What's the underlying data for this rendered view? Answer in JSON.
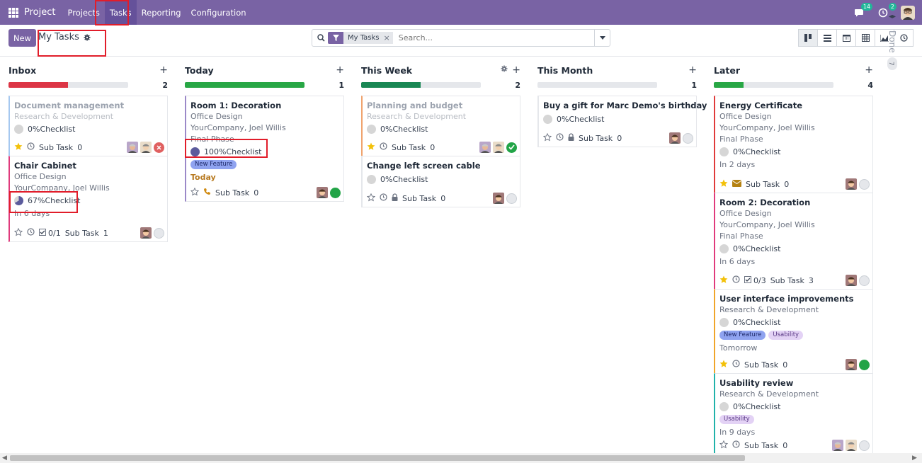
{
  "topbar": {
    "app_name": "Project",
    "menu": [
      {
        "label": "Projects",
        "active": false
      },
      {
        "label": "Tasks",
        "active": true
      },
      {
        "label": "Reporting",
        "active": false
      },
      {
        "label": "Configuration",
        "active": false
      }
    ],
    "messages_count": "14",
    "activities_count": "2"
  },
  "control": {
    "new_label": "New",
    "breadcrumb": "My Tasks",
    "filter_facet": "My Tasks",
    "search_placeholder": "Search..."
  },
  "colors": {
    "brand": "#7963a4",
    "progress_red": "#dc3545",
    "progress_green": "#28a745",
    "progress_dark_green": "#198754"
  },
  "columns": [
    {
      "title": "Inbox",
      "count": "2",
      "gear": false,
      "cards": [
        {
          "title": "Document management",
          "muted": true,
          "lines": [
            "Research & Development"
          ],
          "checklist": "0%Checklist",
          "check_state": "empty",
          "tags": [],
          "deadline": "",
          "starred": true,
          "subtask": "Sub Task",
          "subtask_count": "0",
          "todo": "",
          "status": "cancelled"
        },
        {
          "title": "Chair Cabinet",
          "muted": false,
          "lines": [
            "Office Design",
            "YourCompany, Joel Willis"
          ],
          "checklist": "67%Checklist",
          "check_state": "partial",
          "tags": [],
          "deadline": "In 6 days",
          "starred": false,
          "subtask": "Sub Task",
          "subtask_count": "1",
          "todo": "0/1",
          "status": "normal"
        }
      ]
    },
    {
      "title": "Today",
      "count": "1",
      "gear": false,
      "cards": [
        {
          "title": "Room 1: Decoration",
          "muted": false,
          "lines": [
            "Office Design",
            "YourCompany, Joel Willis",
            "Final Phase"
          ],
          "checklist": "100%Checklist",
          "check_state": "full",
          "tags": [
            "New Feature"
          ],
          "deadline": "Today",
          "starred": false,
          "subtask": "Sub Task",
          "subtask_count": "0",
          "todo": "",
          "status": "green"
        }
      ]
    },
    {
      "title": "This Week",
      "count": "2",
      "gear": true,
      "cards": [
        {
          "title": "Planning and budget",
          "muted": true,
          "lines": [
            "Research & Development"
          ],
          "checklist": "0%Checklist",
          "check_state": "empty",
          "tags": [],
          "deadline": "",
          "starred": true,
          "subtask": "Sub Task",
          "subtask_count": "0",
          "todo": "",
          "status": "done"
        },
        {
          "title": "Change left screen cable",
          "muted": false,
          "lines": [],
          "checklist": "0%Checklist",
          "check_state": "empty",
          "tags": [],
          "deadline": "",
          "starred": false,
          "subtask": "Sub Task",
          "subtask_count": "0",
          "todo": "",
          "status": "normal"
        }
      ]
    },
    {
      "title": "This Month",
      "count": "1",
      "gear": false,
      "cards": [
        {
          "title": "Buy a gift for Marc Demo's birthday",
          "muted": false,
          "lines": [],
          "checklist": "0%Checklist",
          "check_state": "empty",
          "tags": [],
          "deadline": "",
          "starred": false,
          "subtask": "Sub Task",
          "subtask_count": "0",
          "todo": "",
          "status": "normal"
        }
      ]
    },
    {
      "title": "Later",
      "count": "4",
      "gear": false,
      "cards": [
        {
          "title": "Energy Certificate",
          "muted": false,
          "lines": [
            "Office Design",
            "YourCompany, Joel Willis",
            "Final Phase"
          ],
          "checklist": "0%Checklist",
          "check_state": "empty",
          "tags": [],
          "deadline": "In 2 days",
          "starred": true,
          "subtask": "Sub Task",
          "subtask_count": "0",
          "todo": "",
          "status": "normal"
        },
        {
          "title": "Room 2: Decoration",
          "muted": false,
          "lines": [
            "Office Design",
            "YourCompany, Joel Willis",
            "Final Phase"
          ],
          "checklist": "0%Checklist",
          "check_state": "empty",
          "tags": [],
          "deadline": "In 6 days",
          "starred": true,
          "subtask": "Sub Task",
          "subtask_count": "3",
          "todo": "0/3",
          "status": "normal"
        },
        {
          "title": "User interface improvements",
          "muted": false,
          "lines": [
            "Research & Development"
          ],
          "checklist": "0%Checklist",
          "check_state": "empty",
          "tags": [
            "New Feature",
            "Usability"
          ],
          "deadline": "Tomorrow",
          "starred": true,
          "subtask": "Sub Task",
          "subtask_count": "0",
          "todo": "",
          "status": "green"
        },
        {
          "title": "Usability review",
          "muted": false,
          "lines": [
            "Research & Development"
          ],
          "checklist": "0%Checklist",
          "check_state": "empty",
          "tags": [
            "Usability"
          ],
          "deadline": "In 9 days",
          "starred": false,
          "subtask": "Sub Task",
          "subtask_count": "0",
          "todo": "",
          "status": "normal"
        }
      ]
    }
  ],
  "folded": {
    "label": "Done",
    "count": "7"
  }
}
